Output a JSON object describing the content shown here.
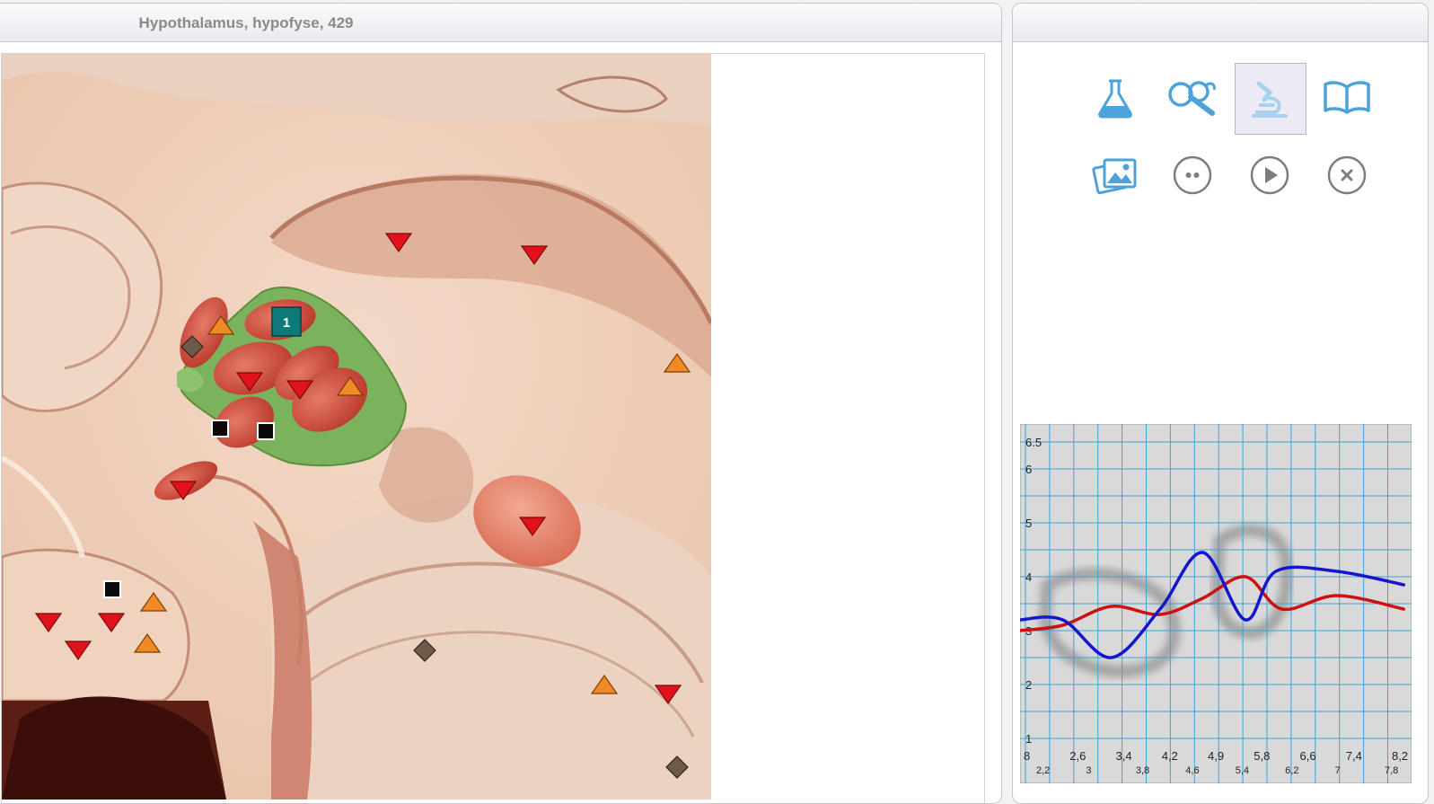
{
  "left_panel": {
    "title": "Hypothalamus, hypofyse, 429",
    "region_badge": "1"
  },
  "toolbar": {
    "row1": [
      {
        "icon": "flask-icon",
        "name": "lab-button"
      },
      {
        "icon": "magnify-icon",
        "name": "search-button"
      },
      {
        "icon": "microscope-icon",
        "name": "microscope-button",
        "active": true
      },
      {
        "icon": "book-icon",
        "name": "atlas-button"
      }
    ],
    "row2": [
      {
        "icon": "gallery-icon",
        "name": "gallery-button"
      },
      {
        "icon": "more-icon",
        "name": "more-button"
      },
      {
        "icon": "play-icon",
        "name": "play-button"
      },
      {
        "icon": "close-icon",
        "name": "close-button"
      }
    ],
    "accent_color": "#4da3d9"
  },
  "chart_data": {
    "type": "line",
    "ylim": [
      1,
      6.5
    ],
    "y_ticks": [
      "1",
      "2",
      "3",
      "4",
      "5",
      "6",
      "6.5"
    ],
    "x_ticks_top": [
      "8",
      "2,6",
      "3,4",
      "4,2",
      "4,9",
      "5,8",
      "6,6",
      "7,4",
      "8,2"
    ],
    "x_ticks_bottom": [
      "2,2",
      "3",
      "3,8",
      "4,6",
      "5,4",
      "6,2",
      "7",
      "7,8"
    ],
    "grid": true,
    "series": [
      {
        "color": "#cc1111",
        "values": [
          [
            1.9,
            3.0
          ],
          [
            2.6,
            3.1
          ],
          [
            3.4,
            3.45
          ],
          [
            4.2,
            3.3
          ],
          [
            4.9,
            3.6
          ],
          [
            5.6,
            4.0
          ],
          [
            6.2,
            3.4
          ],
          [
            7.1,
            3.65
          ],
          [
            8.2,
            3.4
          ]
        ]
      },
      {
        "color": "#1515cc",
        "values": [
          [
            1.9,
            3.2
          ],
          [
            2.6,
            3.2
          ],
          [
            3.4,
            2.5
          ],
          [
            4.2,
            3.4
          ],
          [
            4.9,
            4.45
          ],
          [
            5.6,
            3.2
          ],
          [
            6.1,
            4.1
          ],
          [
            7.1,
            4.1
          ],
          [
            8.2,
            3.85
          ]
        ]
      }
    ]
  }
}
